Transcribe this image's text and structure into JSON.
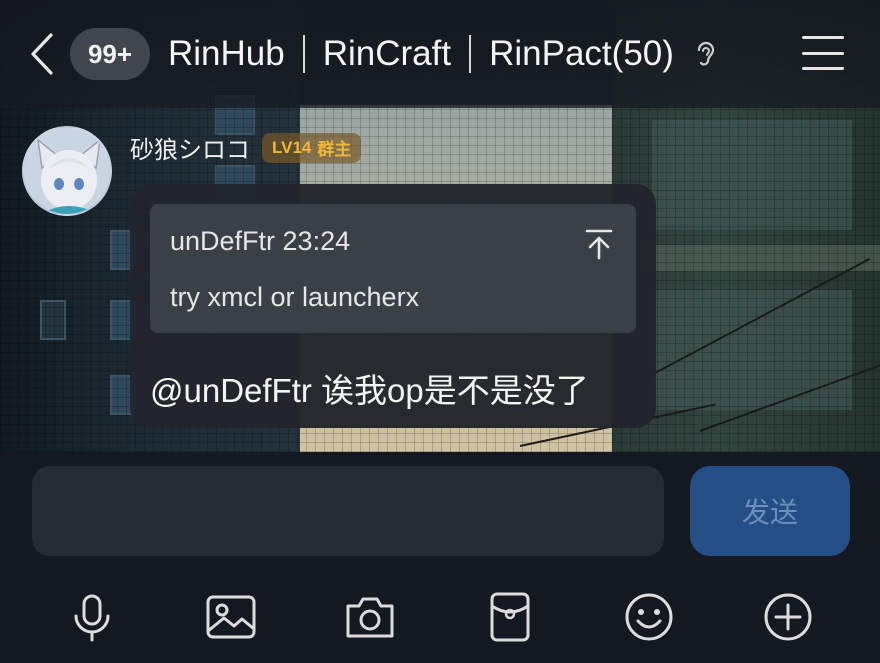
{
  "header": {
    "unread_badge": "99+",
    "title_parts": [
      "RinHub",
      "RinCraft",
      "RinPact(50)"
    ]
  },
  "message": {
    "sender_name": "砂狼シロコ",
    "sender_level": "LV14",
    "sender_role": "群主",
    "quote": {
      "author_time": "unDefFtr 23:24",
      "text": "try xmcl or launcherx"
    },
    "text": "@unDefFtr 诶我op是不是没了"
  },
  "composer": {
    "input_value": "",
    "send_label": "发送"
  },
  "toolbar": {
    "items": [
      "microphone-icon",
      "image-icon",
      "camera-icon",
      "red-packet-icon",
      "emoji-icon",
      "plus-icon"
    ]
  },
  "colors": {
    "send_button_bg": "#234f86",
    "level_badge_text": "#f2b63c",
    "bubble_bg": "#22252b"
  }
}
